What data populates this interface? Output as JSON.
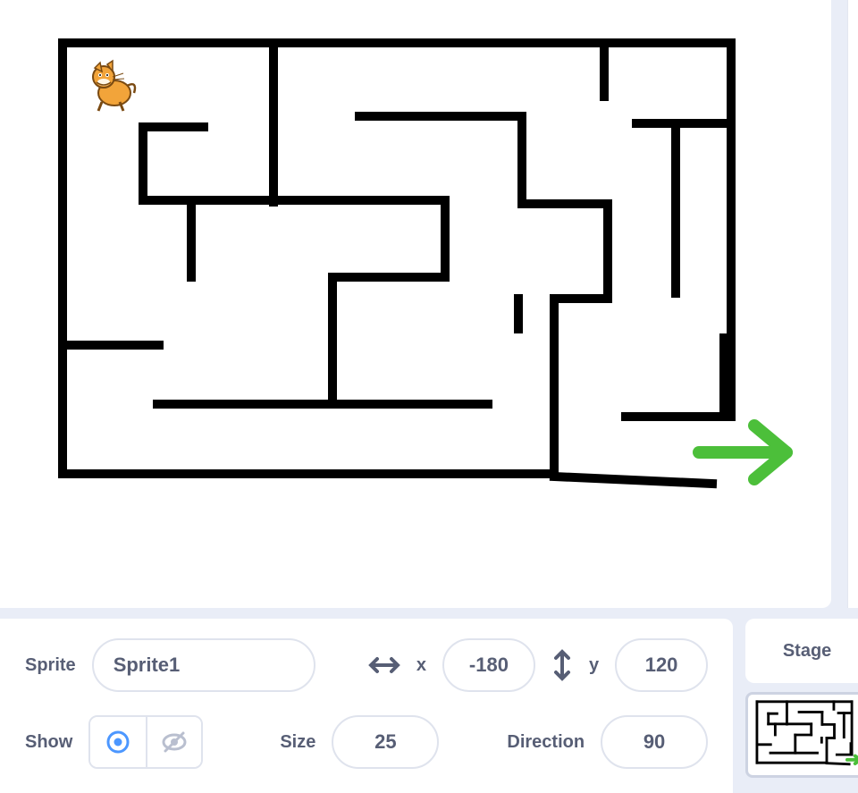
{
  "sprite_panel": {
    "sprite_label": "Sprite",
    "sprite_name": "Sprite1",
    "x_label": "x",
    "x_value": "-180",
    "y_label": "y",
    "y_value": "120",
    "show_label": "Show",
    "size_label": "Size",
    "size_value": "25",
    "direction_label": "Direction",
    "direction_value": "90"
  },
  "stage_panel": {
    "title": "Stage"
  },
  "icons": {
    "arrows_h": "arrows-horizontal-icon",
    "arrows_v": "arrows-vertical-icon",
    "eye_show": "show-icon",
    "eye_hide": "hide-icon",
    "exit_arrow": "exit-arrow-icon"
  },
  "colors": {
    "accent_blue": "#4c97ff",
    "maze_black": "#000000",
    "exit_green": "#4cbf3a",
    "panel_bg": "#e9edf7",
    "text": "#575e75"
  }
}
